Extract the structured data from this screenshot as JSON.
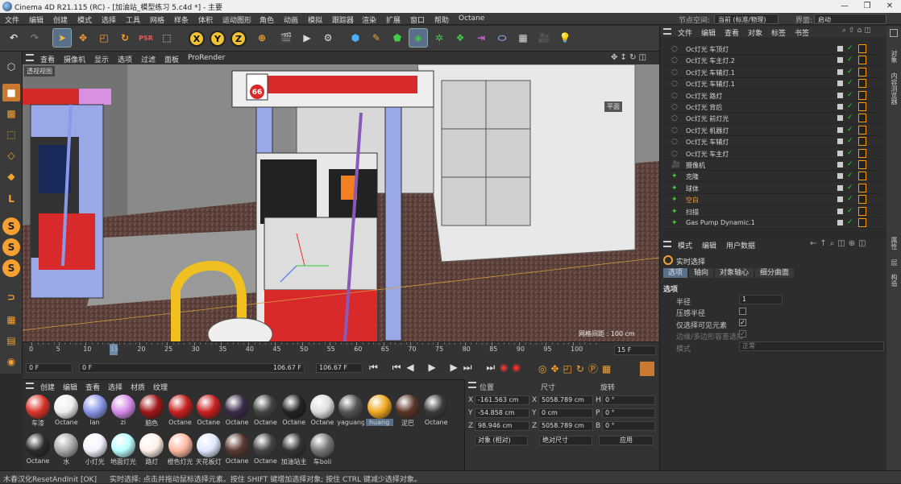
{
  "window": {
    "title": "Cinema 4D R21.115 (RC) - [加油站_模型练习 5.c4d *] - 主要"
  },
  "menubar": {
    "items": [
      "文件",
      "编辑",
      "创建",
      "模式",
      "选择",
      "工具",
      "网格",
      "样条",
      "体积",
      "运动图形",
      "角色",
      "动画",
      "模拟",
      "跟踪器",
      "渲染",
      "扩展",
      "窗口",
      "帮助",
      "Octane"
    ],
    "node_space_label": "节点空间:",
    "node_space_value": "当前 (标准/物理)",
    "layout_label": "界面:",
    "layout_value": "启动"
  },
  "toolbar": {
    "axes": [
      "X",
      "Y",
      "Z"
    ]
  },
  "viewport": {
    "menu": [
      "查看",
      "摄像机",
      "显示",
      "选项",
      "过滤",
      "面板",
      "ProRender"
    ],
    "view_label": "透视视图",
    "grid_info": "网格间距 : 100 cm",
    "plane_label": "平面",
    "sign_text": "66"
  },
  "timeline": {
    "ticks": [
      "0",
      "5",
      "10",
      "15",
      "20",
      "25",
      "30",
      "35",
      "40",
      "45",
      "50",
      "55",
      "60",
      "65",
      "70",
      "75",
      "80",
      "85",
      "90",
      "95",
      "100"
    ],
    "current_frame": "15",
    "frame_display": "15 F",
    "start": "0 F",
    "start2": "0 F",
    "end": "106.67 F",
    "end2": "106.67 F"
  },
  "materials": {
    "menu": [
      "创建",
      "编辑",
      "查看",
      "选择",
      "材质",
      "纹理"
    ],
    "row1": [
      {
        "name": "车漆",
        "color": "#d8352a"
      },
      {
        "name": "Octane",
        "color": "#eeeeee"
      },
      {
        "name": "lan",
        "color": "#8a96e8"
      },
      {
        "name": "zi",
        "color": "#d58be8"
      },
      {
        "name": "脑色",
        "color": "#a01818"
      },
      {
        "name": "Octane",
        "color": "#c82020"
      },
      {
        "name": "Octane",
        "color": "#c82020"
      },
      {
        "name": "Octane",
        "color": "#3a2a4a"
      },
      {
        "name": "Octane",
        "color": "#444444"
      },
      {
        "name": "Octane",
        "color": "#222222"
      },
      {
        "name": "Octane",
        "color": "#dddddd"
      },
      {
        "name": "yaguang",
        "color": "#555555"
      },
      {
        "name": "huang",
        "color": "#f0a820"
      },
      {
        "name": "泥巴",
        "color": "#5a3428"
      },
      {
        "name": "Octane",
        "color": "#3a3a3a"
      }
    ],
    "row2": [
      {
        "name": "Octane",
        "color": "#2a2a2a"
      },
      {
        "name": "水",
        "color": "#aaaaaa"
      },
      {
        "name": "小灯光",
        "color": "#f4f4ff"
      },
      {
        "name": "地面灯光",
        "color": "#bff"
      },
      {
        "name": "路灯",
        "color": "#fff0e8"
      },
      {
        "name": "橙色灯光",
        "color": "#ffb8a0"
      },
      {
        "name": "天花板灯",
        "color": "#e0e8ff"
      },
      {
        "name": "Octane",
        "color": "#5a3a30"
      },
      {
        "name": "Octane",
        "color": "#444444"
      },
      {
        "name": "加油站主",
        "color": "#333333"
      },
      {
        "name": "车boli",
        "color": "#777777"
      }
    ]
  },
  "coords": {
    "headers": [
      "位置",
      "尺寸",
      "旋转"
    ],
    "rows": [
      {
        "axis": "X",
        "pos": "-161.563 cm",
        "size_axis": "X",
        "size": "5058.789 cm",
        "rot_axis": "H",
        "rot": "0 °"
      },
      {
        "axis": "Y",
        "pos": "-54.858 cm",
        "size_axis": "Y",
        "size": "0 cm",
        "rot_axis": "P",
        "rot": "0 °"
      },
      {
        "axis": "Z",
        "pos": "98.946 cm",
        "size_axis": "Z",
        "size": "5058.789 cm",
        "rot_axis": "B",
        "rot": "0 °"
      }
    ],
    "mode1": "对象 (相对)",
    "mode2": "绝对尺寸",
    "apply": "应用"
  },
  "objmgr": {
    "menu": [
      "文件",
      "编辑",
      "查看",
      "对象",
      "标签",
      "书签"
    ],
    "rows": [
      "Oc灯光 车顶灯",
      "Oc灯光 车主灯.2",
      "Oc灯光 车辅灯.1",
      "Oc灯光 车辅灯.1",
      "Oc灯光 路灯",
      "Oc灯光 背后",
      "Oc灯光 前灯光",
      "Oc灯光 机器灯",
      "Oc灯光 车辅灯",
      "Oc灯光 车主灯",
      "摄像机",
      "克隆",
      "球体",
      "空白",
      "扫描",
      "Gas Pump Dynamic.1"
    ]
  },
  "attrmgr": {
    "menu": [
      "模式",
      "编辑",
      "用户数据"
    ],
    "tool_name": "实时选择",
    "tabs": [
      "选项",
      "轴向",
      "对象轴心",
      "细分曲面"
    ],
    "section": "选项",
    "radius_label": "半径",
    "radius_value": "1",
    "pressure_label": "压感半径",
    "visible_only_label": "仅选择可见元素",
    "edge_label": "边缘/多边形容差选择",
    "mode_label": "模式",
    "mode_value": "正常"
  },
  "sidetabs": {
    "top": [
      "对象",
      "内容浏览器"
    ],
    "bottom": [
      "属性",
      "层",
      "构造"
    ]
  },
  "statusbar": {
    "left": "木春汉化ResetAndInit [OK]",
    "text": "实时选择: 点击并拖动鼠标选择元素。按住 SHIFT 键增加选择对象; 按住 CTRL 键减少选择对象。"
  }
}
